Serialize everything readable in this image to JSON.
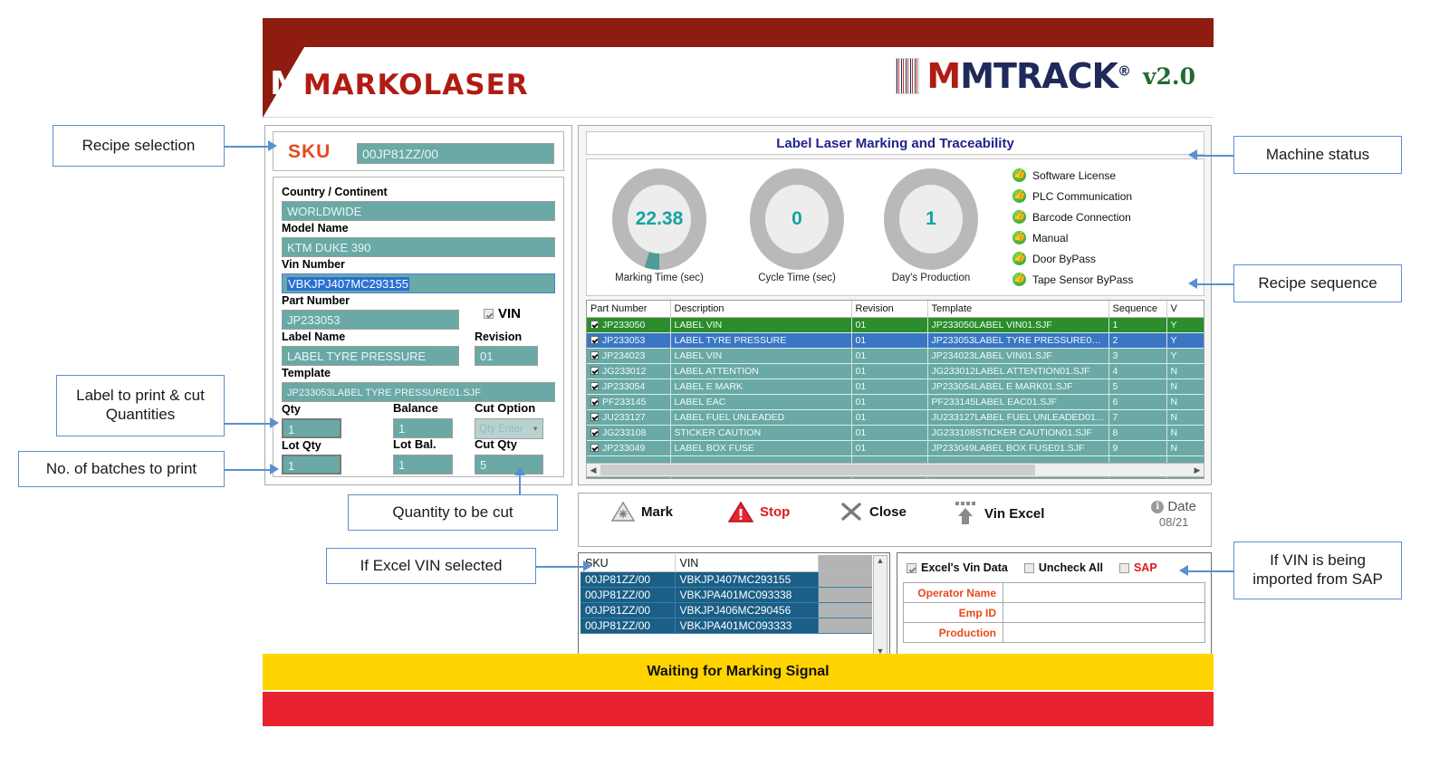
{
  "app": {
    "brand_left": "MARKOLASER",
    "brand_right": "MTRACK",
    "brand_right_reg": "®",
    "version": "v2.0"
  },
  "left_panel": {
    "sku_label": "SKU",
    "sku_value": "00JP81ZZ/00",
    "fields": [
      {
        "label": "Country / Continent",
        "value": "WORLDWIDE"
      },
      {
        "label": "Model Name",
        "value": "KTM DUKE 390"
      },
      {
        "label": "Vin Number",
        "value": "VBKJPJ407MC293155"
      },
      {
        "label": "Part Number",
        "value": "JP233053"
      },
      {
        "label": "Label Name",
        "value": "LABEL TYRE PRESSURE"
      },
      {
        "label": "Revision",
        "value": "01"
      },
      {
        "label": "Template",
        "value": "JP233053LABEL TYRE PRESSURE01.SJF"
      },
      {
        "label": "Qty",
        "value": "1"
      },
      {
        "label": "Balance",
        "value": "1"
      },
      {
        "label": "Cut Option",
        "value": "Qty Enter"
      },
      {
        "label": "Lot Qty",
        "value": "1"
      },
      {
        "label": "Lot Bal.",
        "value": "1"
      },
      {
        "label": "Cut Qty",
        "value": "5"
      }
    ],
    "vin_checkbox_label": "VIN",
    "vin_checkbox_checked": true
  },
  "right_panel": {
    "title": "Label Laser Marking and Traceability",
    "gauges": [
      {
        "value": "22.38",
        "caption": "Marking Time (sec)"
      },
      {
        "value": "0",
        "caption": "Cycle Time (sec)"
      },
      {
        "value": "1",
        "caption": "Day's Production"
      }
    ],
    "status_items": [
      {
        "label": "Software License",
        "state": "ok"
      },
      {
        "label": "PLC Communication",
        "state": "ok"
      },
      {
        "label": "Barcode Connection",
        "state": "ok"
      },
      {
        "label": "Manual",
        "state": "ok"
      },
      {
        "label": "Door ByPass",
        "state": "ok"
      },
      {
        "label": "Tape Sensor ByPass",
        "state": "ok"
      }
    ]
  },
  "sequence_table": {
    "columns": [
      "Part Number",
      "Description",
      "Revision",
      "Template",
      "Sequence",
      "V"
    ],
    "rows": [
      {
        "checked": true,
        "part": "JP233050",
        "desc": "LABEL VIN",
        "rev": "01",
        "template": "JP233050LABEL VIN01.SJF",
        "seq": "1",
        "v": "Y",
        "style": "row-green"
      },
      {
        "checked": true,
        "part": "JP233053",
        "desc": "LABEL TYRE PRESSURE",
        "rev": "01",
        "template": "JP233053LABEL TYRE PRESSURE01...",
        "seq": "2",
        "v": "Y",
        "style": "row-blue"
      },
      {
        "checked": true,
        "part": "JP234023",
        "desc": "LABEL VIN",
        "rev": "01",
        "template": "JP234023LABEL VIN01.SJF",
        "seq": "3",
        "v": "Y",
        "style": "row"
      },
      {
        "checked": true,
        "part": "JG233012",
        "desc": "LABEL ATTENTION",
        "rev": "01",
        "template": "JG233012LABEL ATTENTION01.SJF",
        "seq": "4",
        "v": "N",
        "style": "row"
      },
      {
        "checked": true,
        "part": "JP233054",
        "desc": "LABEL E MARK",
        "rev": "01",
        "template": "JP233054LABEL E MARK01.SJF",
        "seq": "5",
        "v": "N",
        "style": "row"
      },
      {
        "checked": true,
        "part": "PF233145",
        "desc": "LABEL EAC",
        "rev": "01",
        "template": "PF233145LABEL EAC01.SJF",
        "seq": "6",
        "v": "N",
        "style": "row"
      },
      {
        "checked": true,
        "part": "JU233127",
        "desc": "LABEL FUEL UNLEADED",
        "rev": "01",
        "template": "JU233127LABEL FUEL UNLEADED01...",
        "seq": "7",
        "v": "N",
        "style": "row"
      },
      {
        "checked": true,
        "part": "JG233108",
        "desc": "STICKER CAUTION",
        "rev": "01",
        "template": "JG233108STICKER CAUTION01.SJF",
        "seq": "8",
        "v": "N",
        "style": "row"
      },
      {
        "checked": true,
        "part": "JP233049",
        "desc": "LABEL BOX FUSE",
        "rev": "01",
        "template": "JP233049LABEL BOX FUSE01.SJF",
        "seq": "9",
        "v": "N",
        "style": "row"
      }
    ]
  },
  "toolbar": {
    "mark_label": "Mark",
    "stop_label": "Stop",
    "close_label": "Close",
    "vin_excel_label": "Vin Excel",
    "date_label": "Date",
    "date_value": "08/21"
  },
  "vin_grid": {
    "columns": [
      "SKU",
      "VIN",
      ""
    ],
    "rows": [
      {
        "sku": "00JP81ZZ/00",
        "vin": "VBKJPJ407MC293155"
      },
      {
        "sku": "00JP81ZZ/00",
        "vin": "VBKJPA401MC093338"
      },
      {
        "sku": "00JP81ZZ/00",
        "vin": "VBKJPJ406MC290456"
      },
      {
        "sku": "00JP81ZZ/00",
        "vin": "VBKJPA401MC093333"
      }
    ]
  },
  "sap_panel": {
    "checkboxes": [
      {
        "label": "Excel's Vin Data",
        "checked": true
      },
      {
        "label": "Uncheck All",
        "checked": false
      },
      {
        "label": "SAP",
        "checked": false
      }
    ],
    "rows": [
      {
        "key": "Operator Name",
        "value": ""
      },
      {
        "key": "Emp ID",
        "value": ""
      },
      {
        "key": "Production",
        "value": ""
      }
    ]
  },
  "status_bar": {
    "message": "Waiting for Marking Signal"
  },
  "annotations": [
    {
      "id": "recipe-selection",
      "text": "Recipe selection"
    },
    {
      "id": "label-cut-quantities",
      "text": "Label to print & cut Quantities"
    },
    {
      "id": "batches-to-print",
      "text": "No. of batches to print"
    },
    {
      "id": "quantity-to-be-cut",
      "text": "Quantity to be cut"
    },
    {
      "id": "if-excel-vin-selected",
      "text": "If Excel VIN selected"
    },
    {
      "id": "machine-status",
      "text": "Machine status"
    },
    {
      "id": "recipe-sequence",
      "text": "Recipe sequence"
    },
    {
      "id": "vin-from-sap",
      "text": "If VIN is being imported from SAP"
    }
  ],
  "colors": {
    "header_red": "#8e1c11",
    "field_teal": "#6aa9a5",
    "accent_orange": "#e8491d",
    "status_yellow": "#ffd400",
    "status_red": "#e8232f",
    "title_navy": "#22228c"
  }
}
